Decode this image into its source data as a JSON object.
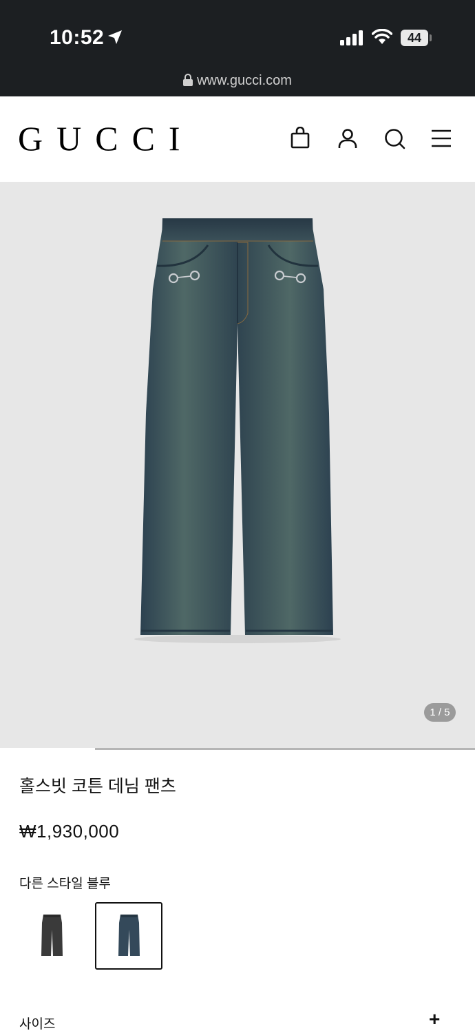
{
  "status_bar": {
    "time": "10:52",
    "battery": "44",
    "url": "www.gucci.com"
  },
  "header": {
    "logo": "GUCCI",
    "icons": [
      "shopping-bag-icon",
      "account-icon",
      "search-icon",
      "menu-icon"
    ]
  },
  "gallery": {
    "counter": "1 / 5",
    "image": "horsebit-denim-pants-photo",
    "progress": 0.2
  },
  "product": {
    "title": "홀스빗 코튼 데님 팬츠",
    "price": "₩1,930,000",
    "style_label": "다른 스타일 블루",
    "swatches": [
      {
        "name": "black-wash",
        "selected": false
      },
      {
        "name": "blue-wash",
        "selected": true
      }
    ],
    "size_label": "사이즈",
    "size_toggle": "+"
  }
}
